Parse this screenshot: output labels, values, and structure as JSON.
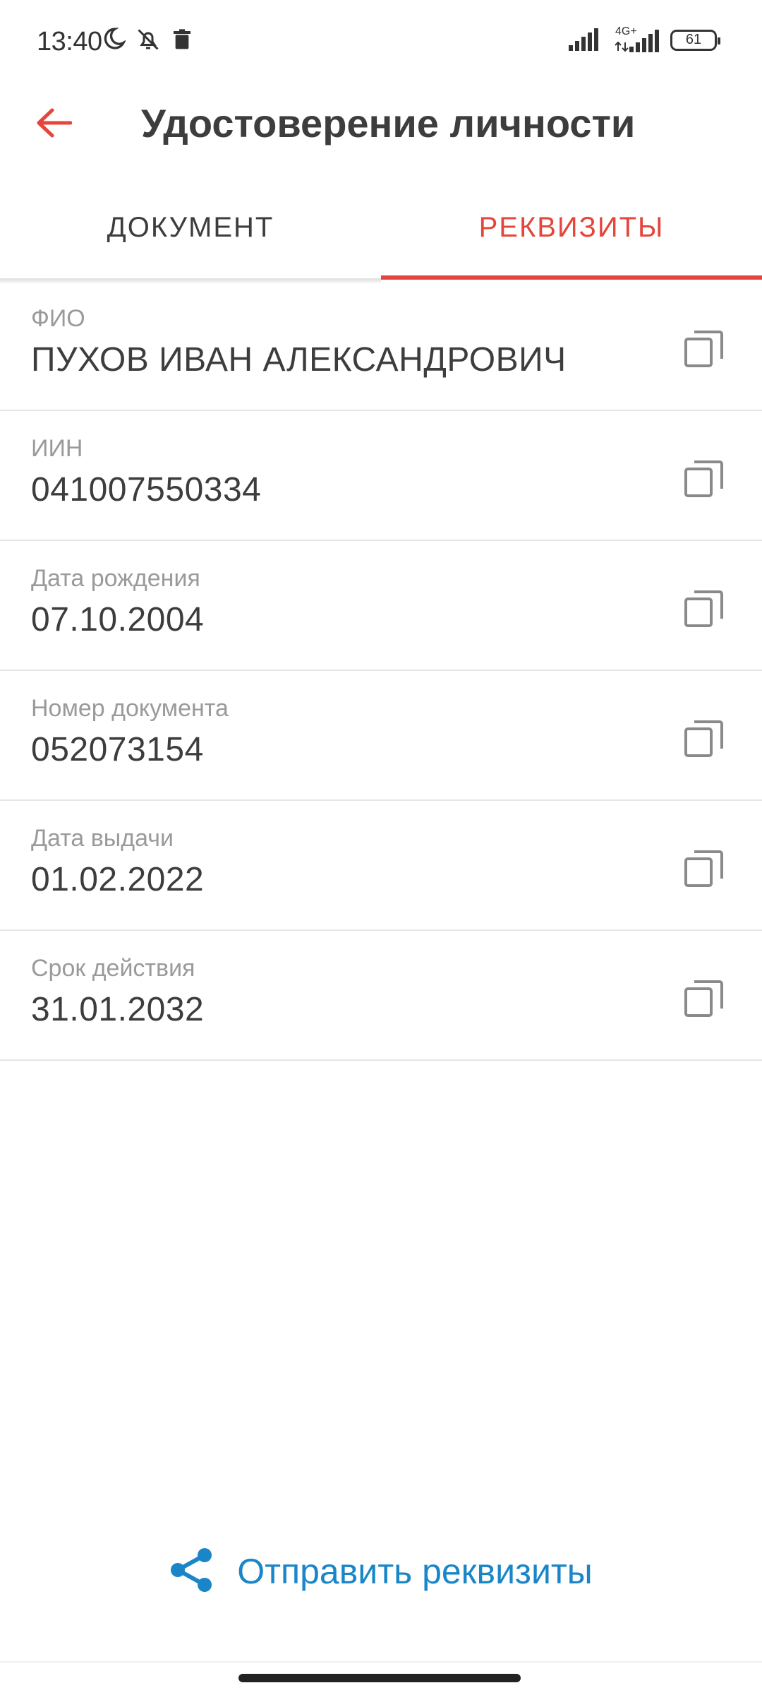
{
  "status_bar": {
    "time": "13:40",
    "network": "4G+",
    "battery": "61",
    "icons": [
      "moon-icon",
      "bell-off-icon",
      "trash-icon",
      "signal-icon",
      "signal-icon",
      "battery-icon"
    ]
  },
  "app_bar": {
    "title": "Удостоверение личности",
    "back_icon": "arrow-left-icon"
  },
  "tabs": [
    {
      "label": "ДОКУМЕНТ",
      "active": false
    },
    {
      "label": "РЕКВИЗИТЫ",
      "active": true
    }
  ],
  "fields": [
    {
      "label": "ФИО",
      "value": "ПУХОВ ИВАН АЛЕКСАНДРОВИЧ"
    },
    {
      "label": "ИИН",
      "value": "041007550334"
    },
    {
      "label": "Дата рождения",
      "value": "07.10.2004"
    },
    {
      "label": "Номер документа",
      "value": "052073154"
    },
    {
      "label": "Дата выдачи",
      "value": "01.02.2022"
    },
    {
      "label": "Срок действия",
      "value": "31.01.2032"
    }
  ],
  "send_action": {
    "label": "Отправить реквизиты",
    "icon": "share-icon"
  },
  "colors": {
    "accent": "#e5453a",
    "link": "#1a86c8",
    "text": "#3d3d3d",
    "label": "#9a9a9a"
  }
}
